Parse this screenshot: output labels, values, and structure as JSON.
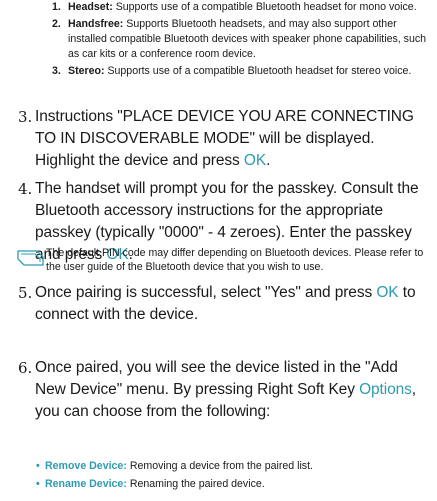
{
  "sublist": [
    {
      "num": "1.",
      "term": "Headset:",
      "text": "Supports use of a compatible Bluetooth headset for mono voice."
    },
    {
      "num": "2.",
      "term": "Handsfree:",
      "text": "Supports Bluetooth headsets, and may also support other installed compatible Bluetooth devices with speaker phone capabilities, such as car kits or a conference room device."
    },
    {
      "num": "3.",
      "term": "Stereo:",
      "text": "Supports use of a compatible Bluetooth headset for stereo voice."
    }
  ],
  "steps": {
    "s3": {
      "num": "3.",
      "text_a": "Instructions \"PLACE DEVICE YOU ARE CONNECTING TO IN DISCOVERABLE MODE\" will be displayed. Highlight the device and press ",
      "kw": "OK",
      "text_b": "."
    },
    "s4": {
      "num": "4.",
      "text_a": "The handset will prompt you for the passkey. Consult the Bluetooth accessory instructions for the appropriate passkey (typically \"0000\" - 4 zeroes). Enter the passkey and press ",
      "kw": "OK",
      "text_b": "."
    },
    "s5": {
      "num": "5.",
      "text_a": "Once pairing is successful, select \"Yes\" and press ",
      "kw": "OK",
      "text_b": " to connect with the device."
    },
    "s6": {
      "num": "6.",
      "text_a": "Once paired, you will see the device listed in the \"Add New Device\" menu. By pressing Right Soft Key ",
      "kw": "Options",
      "text_b": ", you can choose from the following:"
    }
  },
  "note": {
    "text": "The default PIN code may differ depending on Bluetooth devices. Please refer to the user guide of the Bluetooth device that you wish to use.",
    "icon": "note-icon"
  },
  "bullets": [
    {
      "term": "Remove Device:",
      "text": "Removing a device from the paired list."
    },
    {
      "term": "Rename Device:",
      "text": "Renaming the paired device."
    }
  ],
  "colors": {
    "accent": "#2f9bb0",
    "text": "#1a1a1a"
  }
}
